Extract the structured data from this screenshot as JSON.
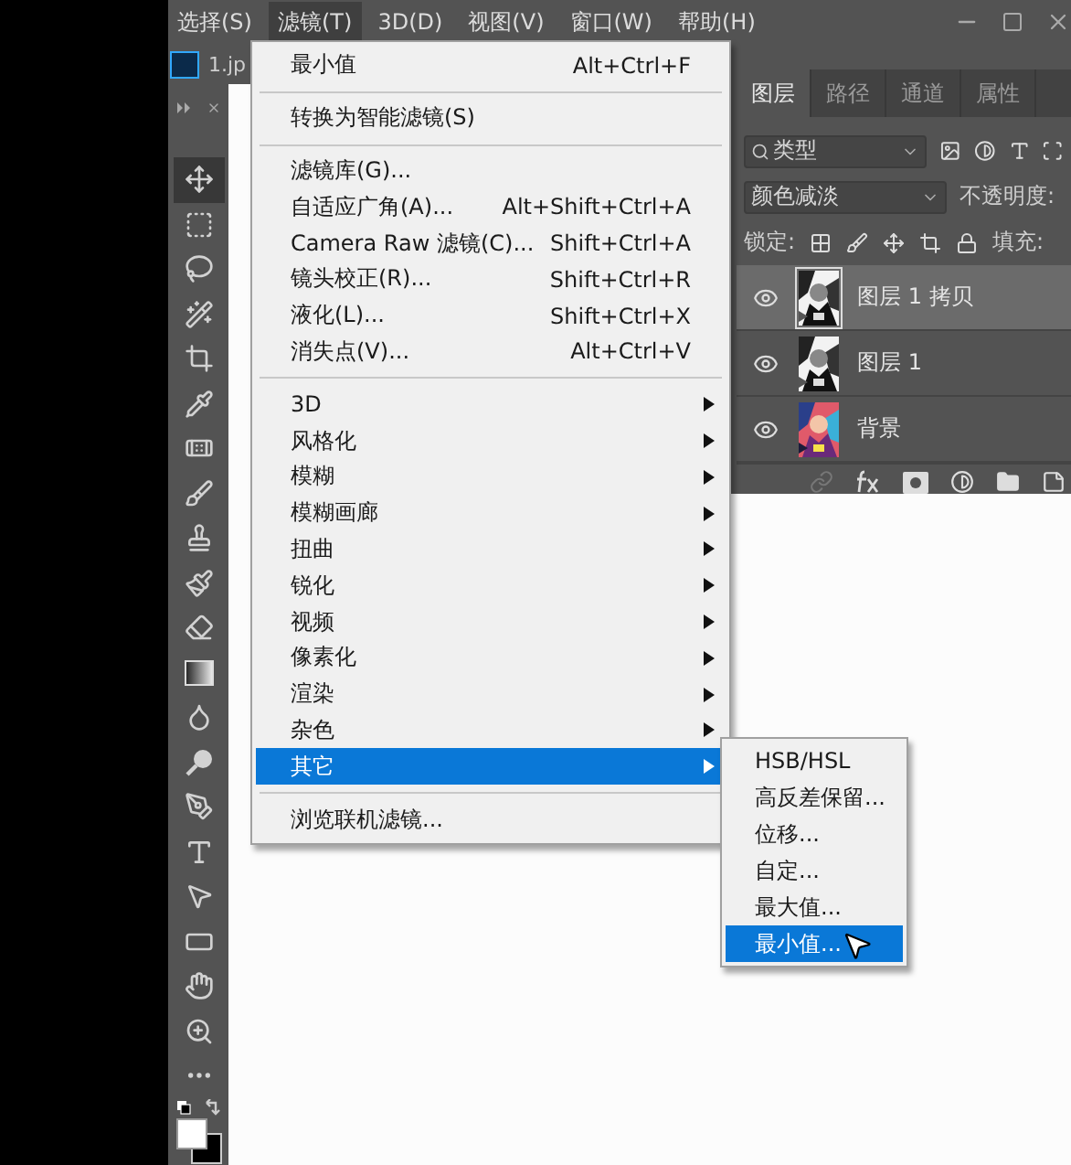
{
  "menu_bar": {
    "items": [
      {
        "label": "选择(S)",
        "selected": false
      },
      {
        "label": "滤镜(T)",
        "selected": true
      },
      {
        "label": "3D(D)",
        "selected": false
      },
      {
        "label": "视图(V)",
        "selected": false
      },
      {
        "label": "窗口(W)",
        "selected": false
      },
      {
        "label": "帮助(H)",
        "selected": false
      }
    ]
  },
  "document_tab": {
    "title": "1.jp"
  },
  "filter_menu": {
    "items": [
      {
        "kind": "item",
        "label": "最小值",
        "shortcut": "Alt+Ctrl+F",
        "submenu": false,
        "selected": false
      },
      {
        "kind": "separator"
      },
      {
        "kind": "item",
        "label": "转换为智能滤镜(S)",
        "submenu": false,
        "selected": false
      },
      {
        "kind": "separator"
      },
      {
        "kind": "item",
        "label": "滤镜库(G)...",
        "submenu": false,
        "selected": false
      },
      {
        "kind": "item",
        "label": "自适应广角(A)...",
        "shortcut": "Alt+Shift+Ctrl+A",
        "submenu": false,
        "selected": false
      },
      {
        "kind": "item",
        "label": "Camera Raw 滤镜(C)...",
        "shortcut": "Shift+Ctrl+A",
        "submenu": false,
        "selected": false
      },
      {
        "kind": "item",
        "label": "镜头校正(R)...",
        "shortcut": "Shift+Ctrl+R",
        "submenu": false,
        "selected": false
      },
      {
        "kind": "item",
        "label": "液化(L)...",
        "shortcut": "Shift+Ctrl+X",
        "submenu": false,
        "selected": false
      },
      {
        "kind": "item",
        "label": "消失点(V)...",
        "shortcut": "Alt+Ctrl+V",
        "submenu": false,
        "selected": false
      },
      {
        "kind": "separator"
      },
      {
        "kind": "item",
        "label": "3D",
        "submenu": true,
        "selected": false
      },
      {
        "kind": "item",
        "label": "风格化",
        "submenu": true,
        "selected": false
      },
      {
        "kind": "item",
        "label": "模糊",
        "submenu": true,
        "selected": false
      },
      {
        "kind": "item",
        "label": "模糊画廊",
        "submenu": true,
        "selected": false
      },
      {
        "kind": "item",
        "label": "扭曲",
        "submenu": true,
        "selected": false
      },
      {
        "kind": "item",
        "label": "锐化",
        "submenu": true,
        "selected": false
      },
      {
        "kind": "item",
        "label": "视频",
        "submenu": true,
        "selected": false
      },
      {
        "kind": "item",
        "label": "像素化",
        "submenu": true,
        "selected": false
      },
      {
        "kind": "item",
        "label": "渲染",
        "submenu": true,
        "selected": false
      },
      {
        "kind": "item",
        "label": "杂色",
        "submenu": true,
        "selected": false
      },
      {
        "kind": "item",
        "label": "其它",
        "submenu": true,
        "selected": true
      },
      {
        "kind": "separator"
      },
      {
        "kind": "item",
        "label": "浏览联机滤镜...",
        "submenu": false,
        "selected": false
      }
    ]
  },
  "other_submenu": {
    "items": [
      {
        "label": "HSB/HSL",
        "selected": false
      },
      {
        "label": "高反差保留...",
        "selected": false
      },
      {
        "label": "位移...",
        "selected": false
      },
      {
        "label": "自定...",
        "selected": false
      },
      {
        "label": "最大值...",
        "selected": false
      },
      {
        "label": "最小值...",
        "selected": true
      }
    ]
  },
  "layers_panel": {
    "tabs": [
      {
        "label": "图层",
        "selected": true
      },
      {
        "label": "路径",
        "selected": false
      },
      {
        "label": "通道",
        "selected": false
      },
      {
        "label": "属性",
        "selected": false
      }
    ],
    "filter": {
      "value": "类型"
    },
    "blend_mode": {
      "value": "颜色减淡"
    },
    "opacity_label": "不透明度:",
    "lock_label": "锁定:",
    "fill_label": "填充:",
    "layers": [
      {
        "name": "图层 1 拷贝",
        "selected": true,
        "visible": true
      },
      {
        "name": "图层 1",
        "selected": false,
        "visible": true
      },
      {
        "name": "背景",
        "selected": false,
        "visible": true
      }
    ]
  }
}
